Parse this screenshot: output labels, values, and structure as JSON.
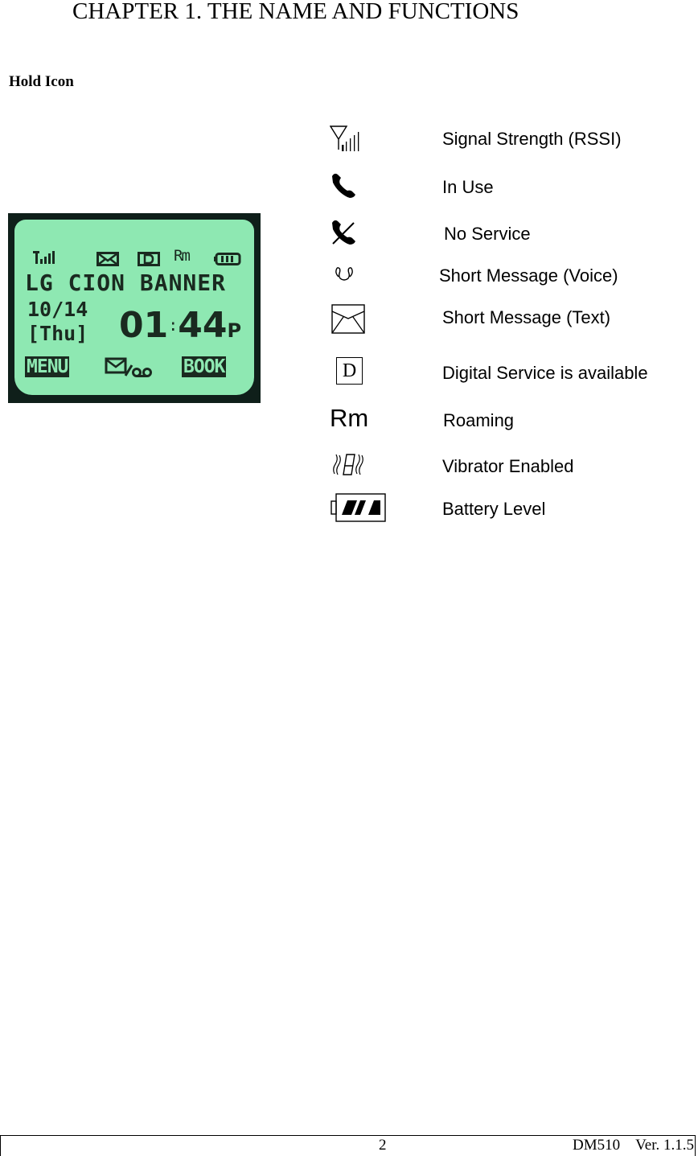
{
  "chapter_title": "CHAPTER 1. THE NAME AND FUNCTIONS",
  "section_heading": "Hold Icon",
  "lcd_display": {
    "status_icons": [
      "signal-strength",
      "text-message",
      "digital-service",
      "roaming",
      "battery"
    ],
    "status_roaming_text": "Rm",
    "banner": "LG CION BANNER",
    "date": "10/14",
    "day": "[Thu]",
    "time_hours": "01",
    "time_sep": ":",
    "time_minutes": "44",
    "time_ampm": "P",
    "softkey_left": "MENU",
    "softkey_center": "✉/∞",
    "softkey_right": "BOOK",
    "colors": {
      "screen": "#8ee8b2",
      "ink": "#1a2a20",
      "bezel": "#0f1f1a"
    }
  },
  "legend": [
    {
      "icon": "signal-strength-icon",
      "label": "Signal Strength (RSSI)"
    },
    {
      "icon": "in-use-phone-icon",
      "label": "In Use"
    },
    {
      "icon": "no-service-phone-icon",
      "label": "No Service"
    },
    {
      "icon": "voice-message-icon",
      "label": "Short Message (Voice)"
    },
    {
      "icon": "text-message-envelope-icon",
      "label": "Short Message (Text)"
    },
    {
      "icon": "digital-service-icon",
      "label": "Digital Service is available",
      "glyph": "D"
    },
    {
      "icon": "roaming-icon",
      "label": "Roaming",
      "glyph": "Rm"
    },
    {
      "icon": "vibrator-icon",
      "label": "Vibrator Enabled"
    },
    {
      "icon": "battery-level-icon",
      "label": "Battery Level"
    }
  ],
  "footer": {
    "page_number": "2",
    "model": "DM510",
    "version": "Ver. 1.1.5"
  }
}
